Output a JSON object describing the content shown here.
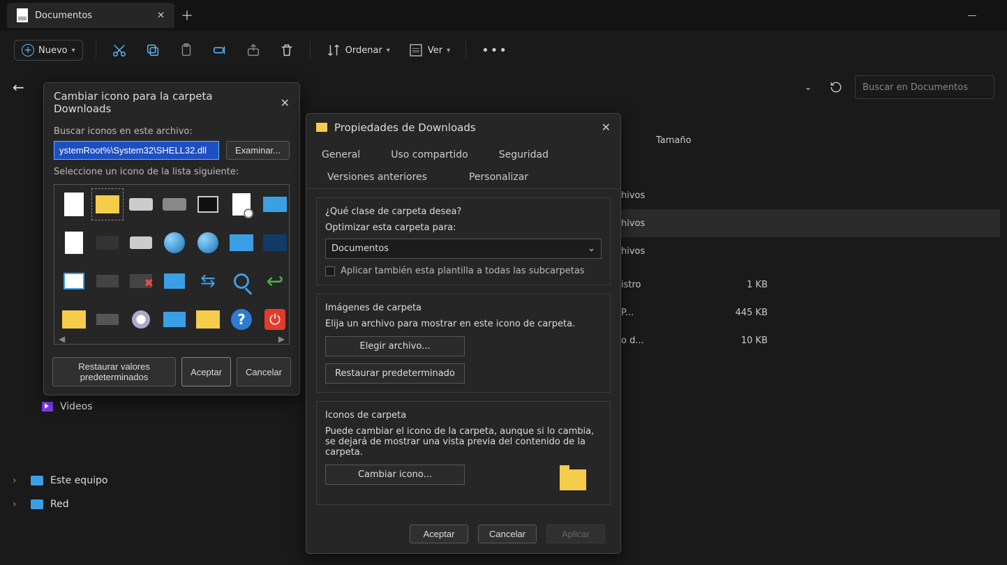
{
  "tab": {
    "title": "Documentos"
  },
  "toolbar": {
    "new_label": "Nuevo",
    "sort_label": "Ordenar",
    "view_label": "Ver"
  },
  "search": {
    "placeholder": "Buscar en Documentos"
  },
  "columns": {
    "size": "Tamaño"
  },
  "file_suffix": "hivos",
  "files": [
    {
      "name": "hivos",
      "size": "",
      "selected": false
    },
    {
      "name": "hivos",
      "size": "",
      "selected": true
    },
    {
      "name": "hivos",
      "size": "",
      "selected": false
    },
    {
      "name": "istro",
      "size": "1 KB",
      "selected": false
    },
    {
      "name": "P...",
      "size": "445 KB",
      "selected": false
    },
    {
      "name": "o d...",
      "size": "10 KB",
      "selected": false
    }
  ],
  "sidebar": {
    "items": [
      {
        "label": "Videos"
      },
      {
        "label": "Este equipo"
      },
      {
        "label": "Red"
      }
    ]
  },
  "icon_dialog": {
    "title": "Cambiar icono para la carpeta Downloads",
    "search_label": "Buscar iconos en este archivo:",
    "path_value": "ystemRoot%\\System32\\SHELL32.dll",
    "browse": "Examinar...",
    "select_label": "Seleccione un icono de la lista siguiente:",
    "restore": "Restaurar valores predeterminados",
    "accept": "Aceptar",
    "cancel": "Cancelar"
  },
  "props_dialog": {
    "title": "Propiedades de Downloads",
    "tabs": {
      "general": "General",
      "sharing": "Uso compartido",
      "security": "Seguridad",
      "versions": "Versiones anteriores",
      "customize": "Personalizar"
    },
    "what_kind": "¿Qué clase de carpeta desea?",
    "optimize_for": "Optimizar esta carpeta para:",
    "optimize_value": "Documentos",
    "apply_subfolders": "Aplicar también esta plantilla a todas las subcarpetas",
    "folder_images": "Imágenes de carpeta",
    "choose_file_hint": "Elija un archivo para mostrar en este icono de carpeta.",
    "choose_file": "Elegir archivo...",
    "restore_default": "Restaurar predeterminado",
    "folder_icons": "Iconos de carpeta",
    "change_hint": "Puede cambiar el icono de la carpeta, aunque si lo cambia, se dejará de mostrar una vista previa del contenido de la carpeta.",
    "change_icon": "Cambiar icono...",
    "accept": "Aceptar",
    "cancel": "Cancelar",
    "apply": "Aplicar"
  }
}
